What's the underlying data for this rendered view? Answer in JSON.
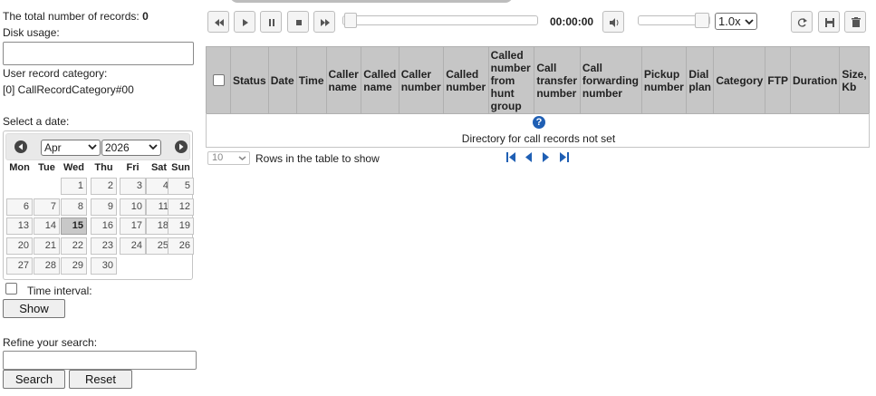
{
  "left": {
    "records_label": "The total number of records:",
    "records_count": "0",
    "disk_usage_label": "Disk usage:",
    "category_label": "User record category:",
    "category_value": "[0] CallRecordCategory#00",
    "select_date_label": "Select a date:",
    "calendar": {
      "month": "Apr",
      "year": "2026",
      "weekdays": [
        "Mon",
        "Tue",
        "Wed",
        "Thu",
        "Fri",
        "Sat",
        "Sun"
      ],
      "days": [
        "1",
        "2",
        "3",
        "4",
        "5",
        "6",
        "7",
        "8",
        "9",
        "10",
        "11",
        "12",
        "13",
        "14",
        "15",
        "16",
        "17",
        "18",
        "19",
        "20",
        "21",
        "22",
        "23",
        "24",
        "25",
        "26",
        "27",
        "28",
        "29",
        "30"
      ],
      "today": "15"
    },
    "time_interval_label": "Time interval:",
    "show_button": "Show",
    "refine_label": "Refine your search:",
    "search_button": "Search",
    "reset_button": "Reset"
  },
  "player": {
    "time": "00:00:00",
    "speed": "1.0x"
  },
  "table": {
    "headers": [
      "Status",
      "Date",
      "Time",
      "Caller name",
      "Called name",
      "Caller number",
      "Called number",
      "Called number from hunt group",
      "Call transfer number",
      "Call forwarding number",
      "Pickup number",
      "Dial plan",
      "Category",
      "FTP",
      "Duration",
      "Size, Kb"
    ],
    "empty_message": "Directory for call records not set",
    "rows_per_page": "10",
    "rows_label": "Rows in the table to show"
  },
  "colors": {
    "header_bg": "#c6c6c6",
    "help_icon": "#1f5fb4",
    "pager_icon": "#1f5fb4"
  }
}
